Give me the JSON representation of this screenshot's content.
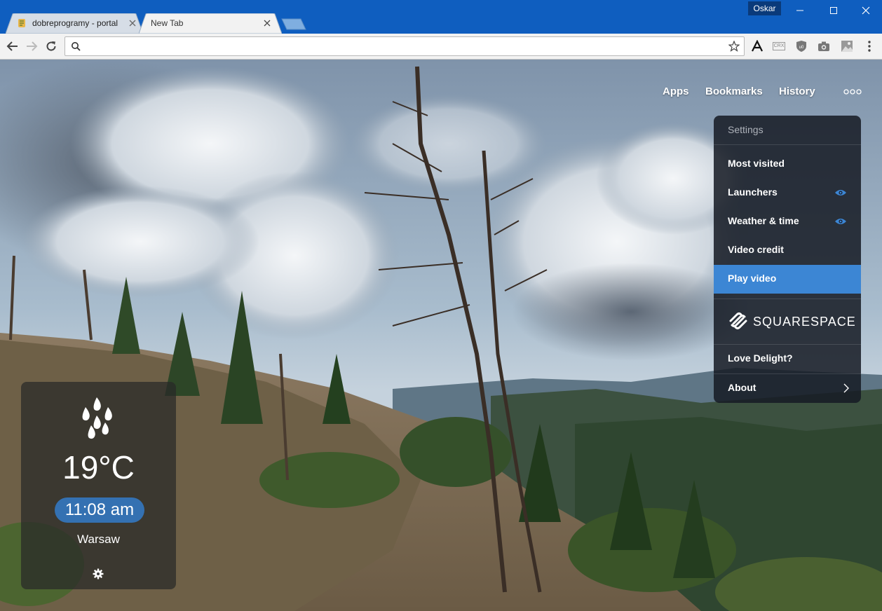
{
  "window": {
    "profile_name": "Oskar",
    "controls": [
      "minimize-icon",
      "maximize-icon",
      "close-icon"
    ]
  },
  "tabs": [
    {
      "title": "dobreprogramy - portal",
      "favicon": "dobreprogramy-favicon",
      "active": false
    },
    {
      "title": "New Tab",
      "active": true
    }
  ],
  "toolbar": {
    "omnibox_value": "",
    "extensions": [
      "font-a-icon",
      "crx-icon",
      "ublock-icon",
      "camera-icon",
      "image-icon",
      "menu-icon"
    ],
    "crx_label": "CRX"
  },
  "page": {
    "nav": {
      "apps": "Apps",
      "bookmarks": "Bookmarks",
      "history": "History"
    },
    "settings_menu": {
      "header": "Settings",
      "items": [
        {
          "label": "Most visited",
          "icon": null
        },
        {
          "label": "Launchers",
          "icon": "eye-icon"
        },
        {
          "label": "Weather & time",
          "icon": "eye-icon"
        },
        {
          "label": "Video credit",
          "icon": null
        },
        {
          "label": "Play video",
          "icon": null,
          "active": true
        }
      ],
      "sponsor": "SQUARESPACE",
      "love": "Love Delight?",
      "about": "About"
    },
    "weather": {
      "icon": "rain-icon",
      "temperature": "19°C",
      "time": "11:08 am",
      "city": "Warsaw"
    }
  },
  "colors": {
    "titlebar": "#0f5ebf",
    "accent": "#3c86d4",
    "time_pill": "#3471b2"
  }
}
